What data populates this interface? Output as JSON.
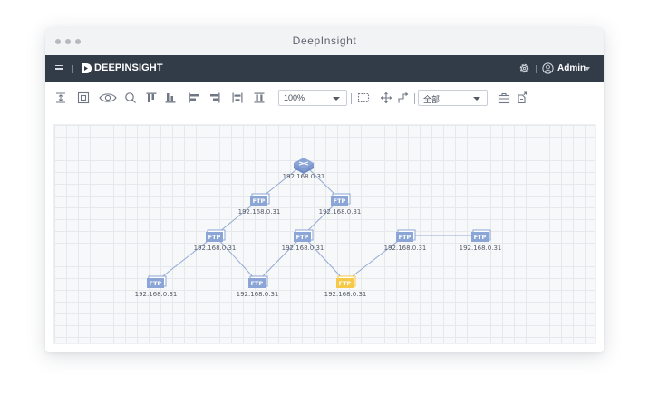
{
  "window": {
    "title": "DeepInsight"
  },
  "header": {
    "brand": "DEEPINSIGHT",
    "user": "Admin"
  },
  "toolbar": {
    "zoom_value": "100%",
    "filter_value": "全部",
    "icons": [
      "fit-height-icon",
      "fit-screen-icon",
      "preview-eye-icon",
      "search-icon",
      "align-top-icon",
      "align-bottom-icon",
      "align-left-icon",
      "align-right-icon",
      "distribute-horizontal-icon",
      "distribute-vertical-icon",
      "box-select-icon",
      "move-icon",
      "connector-icon",
      "toolbox-icon",
      "export-icon"
    ]
  },
  "topology": {
    "colors": {
      "node": "#8ba5d6",
      "highlight": "#f7c948",
      "edge": "#93a9d4"
    },
    "nodes": [
      {
        "id": "router",
        "type": "router",
        "label": "192.168.0.31"
      },
      {
        "id": "ftp1",
        "type": "ftp",
        "text": "FTP",
        "label": "192.168.0.31"
      },
      {
        "id": "ftp2",
        "type": "ftp",
        "text": "FTP",
        "label": "192.168.0.31"
      },
      {
        "id": "ftp3",
        "type": "ftp",
        "text": "FTP",
        "label": "192.168.0.31"
      },
      {
        "id": "ftp4",
        "type": "ftp",
        "text": "FTP",
        "label": "192.168.0.31"
      },
      {
        "id": "ftp5",
        "type": "ftp",
        "text": "FTP",
        "label": "192.168.0.31"
      },
      {
        "id": "ftp6",
        "type": "ftp",
        "text": "FTP",
        "label": "192.168.0.31"
      },
      {
        "id": "ftp7",
        "type": "ftp",
        "text": "FTP",
        "label": "192.168.0.31"
      },
      {
        "id": "ftp8",
        "type": "ftp",
        "text": "FTP",
        "label": "192.168.0.31",
        "highlight": true
      },
      {
        "id": "ftp9",
        "type": "ftp",
        "text": "FTP",
        "label": "192.168.0.31"
      }
    ],
    "edges": [
      [
        "router",
        "ftp1"
      ],
      [
        "router",
        "ftp2"
      ],
      [
        "ftp1",
        "ftp3"
      ],
      [
        "ftp2",
        "ftp4"
      ],
      [
        "ftp3",
        "ftp6"
      ],
      [
        "ftp3",
        "ftp7"
      ],
      [
        "ftp4",
        "ftp7"
      ],
      [
        "ftp4",
        "ftp8"
      ],
      [
        "ftp8",
        "ftp5"
      ],
      [
        "ftp5",
        "ftp9"
      ]
    ]
  }
}
